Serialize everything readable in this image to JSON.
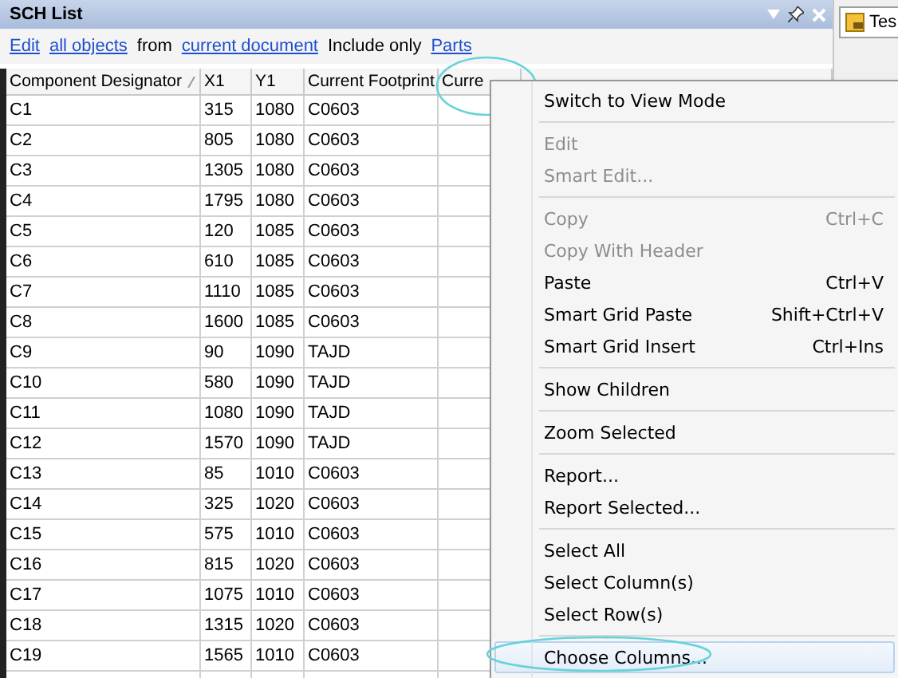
{
  "panel": {
    "title": "SCH List",
    "side_tab": "Tes"
  },
  "filter": [
    {
      "kind": "link",
      "text": "Edit"
    },
    {
      "kind": "link",
      "text": "all objects"
    },
    {
      "kind": "text",
      "text": "from"
    },
    {
      "kind": "link",
      "text": "current document"
    },
    {
      "kind": "text",
      "text": "Include only"
    },
    {
      "kind": "link",
      "text": "Parts"
    }
  ],
  "table": {
    "columns": [
      {
        "label": "Component Designator",
        "sorted": true
      },
      {
        "label": "X1",
        "sorted": false
      },
      {
        "label": "Y1",
        "sorted": false
      },
      {
        "label": "Current Footprint",
        "sorted": false
      },
      {
        "label": "Curre",
        "sorted": false
      }
    ],
    "rows": [
      [
        "C1",
        "315",
        "1080",
        "C0603"
      ],
      [
        "C2",
        "805",
        "1080",
        "C0603"
      ],
      [
        "C3",
        "1305",
        "1080",
        "C0603"
      ],
      [
        "C4",
        "1795",
        "1080",
        "C0603"
      ],
      [
        "C5",
        "120",
        "1085",
        "C0603"
      ],
      [
        "C6",
        "610",
        "1085",
        "C0603"
      ],
      [
        "C7",
        "1110",
        "1085",
        "C0603"
      ],
      [
        "C8",
        "1600",
        "1085",
        "C0603"
      ],
      [
        "C9",
        "90",
        "1090",
        "TAJD"
      ],
      [
        "C10",
        "580",
        "1090",
        "TAJD"
      ],
      [
        "C11",
        "1080",
        "1090",
        "TAJD"
      ],
      [
        "C12",
        "1570",
        "1090",
        "TAJD"
      ],
      [
        "C13",
        "85",
        "1010",
        "C0603"
      ],
      [
        "C14",
        "325",
        "1020",
        "C0603"
      ],
      [
        "C15",
        "575",
        "1010",
        "C0603"
      ],
      [
        "C16",
        "815",
        "1020",
        "C0603"
      ],
      [
        "C17",
        "1075",
        "1010",
        "C0603"
      ],
      [
        "C18",
        "1315",
        "1020",
        "C0603"
      ],
      [
        "C19",
        "1565",
        "1010",
        "C0603"
      ]
    ]
  },
  "context_menu": [
    {
      "kind": "item",
      "label": "Switch to View Mode",
      "disabled": false,
      "highlighted": false
    },
    {
      "kind": "separator"
    },
    {
      "kind": "item",
      "label": "Edit",
      "disabled": true,
      "highlighted": false
    },
    {
      "kind": "item",
      "label": "Smart Edit...",
      "disabled": true,
      "highlighted": false
    },
    {
      "kind": "separator"
    },
    {
      "kind": "item",
      "label": "Copy",
      "shortcut": "Ctrl+C",
      "disabled": true,
      "highlighted": false
    },
    {
      "kind": "item",
      "label": "Copy With Header",
      "disabled": true,
      "highlighted": false
    },
    {
      "kind": "item",
      "label": "Paste",
      "shortcut": "Ctrl+V",
      "disabled": false,
      "highlighted": false
    },
    {
      "kind": "item",
      "label": "Smart Grid Paste",
      "shortcut": "Shift+Ctrl+V",
      "disabled": false,
      "highlighted": false
    },
    {
      "kind": "item",
      "label": "Smart Grid Insert",
      "shortcut": "Ctrl+Ins",
      "disabled": false,
      "highlighted": false
    },
    {
      "kind": "separator"
    },
    {
      "kind": "item",
      "label": "Show Children",
      "disabled": false,
      "highlighted": false
    },
    {
      "kind": "separator"
    },
    {
      "kind": "item",
      "label": "Zoom Selected",
      "disabled": false,
      "highlighted": false
    },
    {
      "kind": "separator"
    },
    {
      "kind": "item",
      "label": "Report...",
      "disabled": false,
      "highlighted": false
    },
    {
      "kind": "item",
      "label": "Report Selected...",
      "disabled": false,
      "highlighted": false
    },
    {
      "kind": "separator"
    },
    {
      "kind": "item",
      "label": "Select All",
      "disabled": false,
      "highlighted": false
    },
    {
      "kind": "item",
      "label": "Select Column(s)",
      "disabled": false,
      "highlighted": false
    },
    {
      "kind": "item",
      "label": "Select Row(s)",
      "disabled": false,
      "highlighted": false
    },
    {
      "kind": "separator"
    },
    {
      "kind": "item",
      "label": "Choose Columns...",
      "disabled": false,
      "highlighted": true
    }
  ]
}
